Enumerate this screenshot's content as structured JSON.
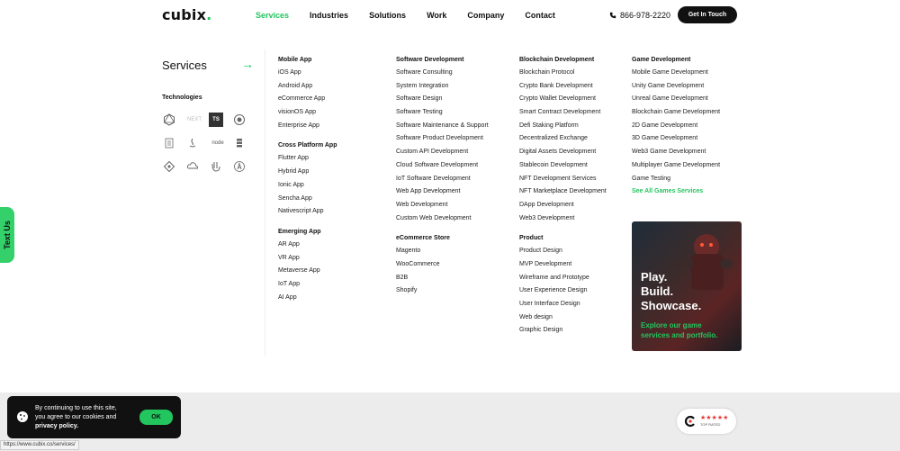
{
  "header": {
    "logo": "cubix",
    "logo_dot": ".",
    "nav": [
      "Services",
      "Industries",
      "Solutions",
      "Work",
      "Company",
      "Contact"
    ],
    "active_nav": "Services",
    "phone": "866-978-2220",
    "cta": "Get In Touch"
  },
  "left": {
    "title": "Services",
    "arrow": "→",
    "technologies_title": "Technologies",
    "tech_icons": [
      "graphql-icon",
      "nextjs-icon",
      "typescript-icon",
      "nestjs-icon",
      "document-icon",
      "java-icon",
      "nodejs-icon",
      "database-icon",
      "diamond-icon",
      "api-cloud-icon",
      "hashnode-icon",
      "angular-icon"
    ],
    "tech_labels": {
      "next": "NEXT",
      "ts": "TS",
      "node": "node"
    }
  },
  "columns": [
    {
      "groups": [
        {
          "heading": "Mobile App",
          "items": [
            "iOS App",
            "Android App",
            "eCommerce App",
            "visionOS App",
            "Enterprise App"
          ]
        },
        {
          "heading": "Cross Platform App",
          "items": [
            "Flutter App",
            "Hybrid App",
            "Ionic App",
            "Sencha App",
            "Nativescript App"
          ]
        },
        {
          "heading": "Emerging App",
          "items": [
            "AR App",
            "VR App",
            "Metaverse App",
            "IoT App",
            "AI App"
          ]
        }
      ]
    },
    {
      "groups": [
        {
          "heading": "Software Development",
          "items": [
            "Software Consulting",
            "System Integration",
            "Software Design",
            "Software Testing",
            "Software Maintenance & Support",
            "Software Product Development",
            "Custom API Development",
            "Cloud Software Development",
            "IoT Software Development",
            "Web App Development",
            "Web Development",
            "Custom Web Development"
          ]
        },
        {
          "heading": "eCommerce Store",
          "items": [
            "Magento",
            "WooCommerce",
            "B2B",
            "Shopify"
          ]
        }
      ]
    },
    {
      "groups": [
        {
          "heading": "Blockchain Development",
          "items": [
            "Blockchain Protocol",
            "Crypto Bank Development",
            "Crypto Wallet Development",
            "Smart Contract Development",
            "Defi Staking Platform",
            "Decentralized Exchange",
            "Digital Assets Development",
            "Stablecoin Development",
            "NFT Development Services",
            "NFT Marketplace Development",
            "DApp Development",
            "Web3 Development"
          ]
        },
        {
          "heading": "Product",
          "items": [
            "Product Design",
            "MVP Development",
            "Wireframe and Prototype",
            "User Experience Design",
            "User Interface Design",
            "Web design",
            "Graphic Design"
          ]
        }
      ]
    },
    {
      "groups": [
        {
          "heading": "Game Development",
          "items": [
            "Mobile Game Development",
            "Unity Game Development",
            "Unreal Game Development",
            "Blockchain Game Development",
            "2D Game Development",
            "3D Game Development",
            "Web3 Game Development",
            "Multiplayer Game Development",
            "Game Testing"
          ],
          "link": "See All Games Services"
        }
      ]
    }
  ],
  "promo": {
    "line1": "Play.",
    "line2": "Build.",
    "line3": "Showcase.",
    "sub1": "Explore our game",
    "sub2": "services and portfolio."
  },
  "side_tab": "Text Us",
  "cookie": {
    "line1": "By continuing to use this site,",
    "line2": "you agree to our cookies and",
    "line3": "privacy policy.",
    "ok": "OK"
  },
  "status_url": "https://www.cubix.co/services/",
  "badge": {
    "stars": "★★★★★",
    "text": "TOP RATED"
  },
  "colors": {
    "accent": "#22c55e",
    "dark": "#111111"
  }
}
